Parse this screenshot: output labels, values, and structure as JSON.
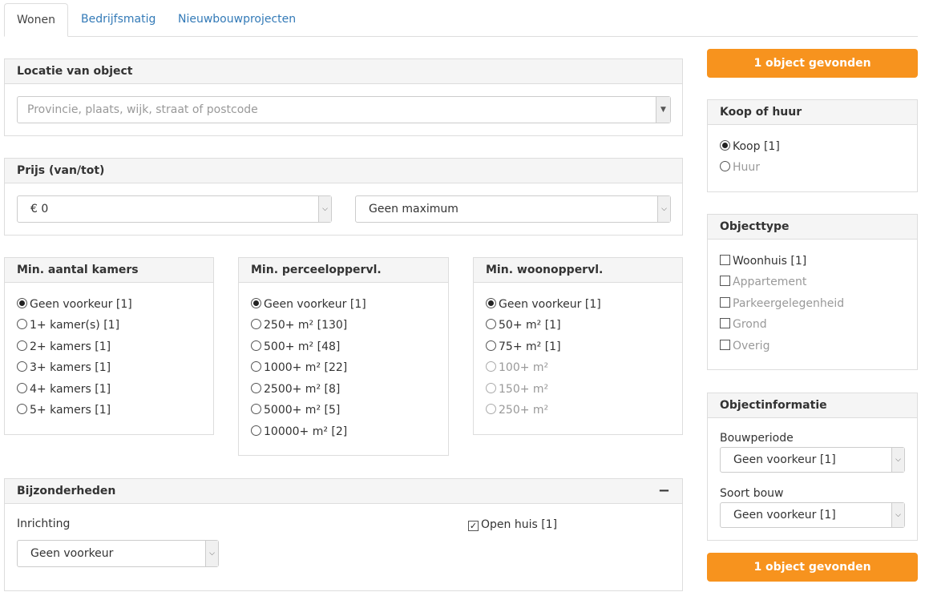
{
  "tabs": [
    "Wonen",
    "Bedrijfsmatig",
    "Nieuwbouwprojecten"
  ],
  "locatie": {
    "heading": "Locatie van object",
    "placeholder": "Provincie, plaats, wijk, straat of postcode"
  },
  "prijs": {
    "heading": "Prijs (van/tot)",
    "min": "€ 0",
    "max": "Geen maximum"
  },
  "kamers": {
    "heading": "Min. aantal kamers",
    "options": [
      "Geen voorkeur [1]",
      "1+ kamer(s) [1]",
      "2+ kamers [1]",
      "3+ kamers [1]",
      "4+ kamers [1]",
      "5+ kamers [1]"
    ]
  },
  "perceel": {
    "heading": "Min. perceeloppervl.",
    "options": [
      "Geen voorkeur [1]",
      "250+ m² [130]",
      "500+ m² [48]",
      "1000+ m² [22]",
      "2500+ m² [8]",
      "5000+ m² [5]",
      "10000+ m² [2]"
    ]
  },
  "woon": {
    "heading": "Min. woonoppervl.",
    "options": [
      "Geen voorkeur [1]",
      "50+ m² [1]",
      "75+ m² [1]",
      "100+ m²",
      "150+ m²",
      "250+ m²"
    ]
  },
  "bijzonderheden": {
    "heading": "Bijzonderheden",
    "toggle": "−",
    "inrichting_label": "Inrichting",
    "inrichting_value": "Geen voorkeur",
    "open_huis": "Open huis [1]",
    "open_huis_check": "✓"
  },
  "result_button": "1 object gevonden",
  "koop_huur": {
    "heading": "Koop of huur",
    "options": [
      "Koop [1]",
      "Huur"
    ]
  },
  "objecttype": {
    "heading": "Objecttype",
    "options": [
      "Woonhuis [1]",
      "Appartement",
      "Parkeergelegenheid",
      "Grond",
      "Overig"
    ]
  },
  "objectinfo": {
    "heading": "Objectinformatie",
    "bouwperiode_label": "Bouwperiode",
    "bouwperiode_value": "Geen voorkeur [1]",
    "soort_label": "Soort bouw",
    "soort_value": "Geen voorkeur [1]"
  },
  "icons": {
    "dropdown": "chevron-down-icon",
    "caret": "▼"
  },
  "colors": {
    "accent": "#f7931e",
    "link": "#337ab7"
  }
}
